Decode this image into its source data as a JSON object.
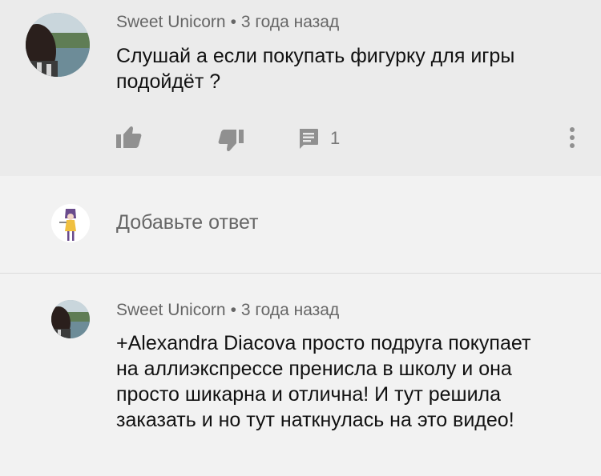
{
  "top_comment": {
    "author": "Sweet Unicorn",
    "separator": "•",
    "time": "3 года назад",
    "text": "Слушай а если покупать фигурку для игры подойдёт ?",
    "reply_count": "1"
  },
  "reply_box": {
    "placeholder": "Добавьте ответ"
  },
  "reply": {
    "author": "Sweet Unicorn",
    "separator": "•",
    "time": "3 года назад",
    "text": "+Alexandra Diacova просто подруга покупает на аллиэкспрессе пренисла в школу и она просто шикарна и отлична! И тут решила заказать и но тут наткнулась на это видео!"
  },
  "icons": [
    "avatar",
    "like-icon",
    "dislike-icon",
    "comment-icon",
    "more-vert-icon"
  ]
}
